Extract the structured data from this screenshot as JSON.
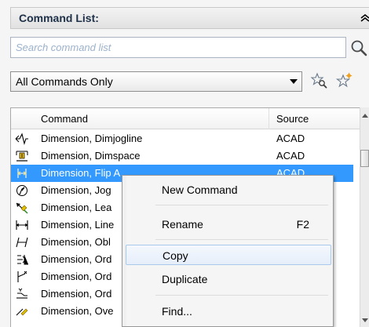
{
  "panel": {
    "title": "Command List:"
  },
  "search": {
    "placeholder": "Search command list",
    "value": ""
  },
  "filter": {
    "selected": "All Commands Only"
  },
  "table": {
    "headers": {
      "command": "Command",
      "source": "Source"
    },
    "rows": [
      {
        "name": "Dimension, Dimjogline",
        "source": "ACAD",
        "icon": "dimjogline-icon"
      },
      {
        "name": "Dimension, Dimspace",
        "source": "ACAD",
        "icon": "dimspace-icon"
      },
      {
        "name": "Dimension, Flip A",
        "source": "ACAD",
        "icon": "flip-arrow-icon",
        "selected": true
      },
      {
        "name": "Dimension, Jog",
        "source": "",
        "icon": "jog-icon"
      },
      {
        "name": "Dimension, Lea",
        "source": "",
        "icon": "leader-icon"
      },
      {
        "name": "Dimension, Line",
        "source": "",
        "icon": "linear-icon"
      },
      {
        "name": "Dimension, Obl",
        "source": "",
        "icon": "oblique-icon"
      },
      {
        "name": "Dimension, Ord",
        "source": "",
        "icon": "ordinate-icon"
      },
      {
        "name": "Dimension, Ord",
        "source": "",
        "icon": "ordinate-x-icon"
      },
      {
        "name": "Dimension, Ord",
        "source": "",
        "icon": "ordinate-y-icon"
      },
      {
        "name": "Dimension, Ove",
        "source": "",
        "icon": "override-icon"
      }
    ]
  },
  "context_menu": {
    "items": [
      {
        "label": "New Command",
        "shortcut": ""
      },
      {
        "label": "Rename",
        "shortcut": "F2"
      },
      {
        "label": "Copy",
        "shortcut": "",
        "hover": true
      },
      {
        "label": "Duplicate",
        "shortcut": ""
      },
      {
        "label": "Find...",
        "shortcut": ""
      }
    ]
  },
  "colors": {
    "selection": "#3399ff",
    "title": "#1e3048",
    "placeholder": "#9bb1cc",
    "menu_hover_border": "#a8c8ec"
  }
}
